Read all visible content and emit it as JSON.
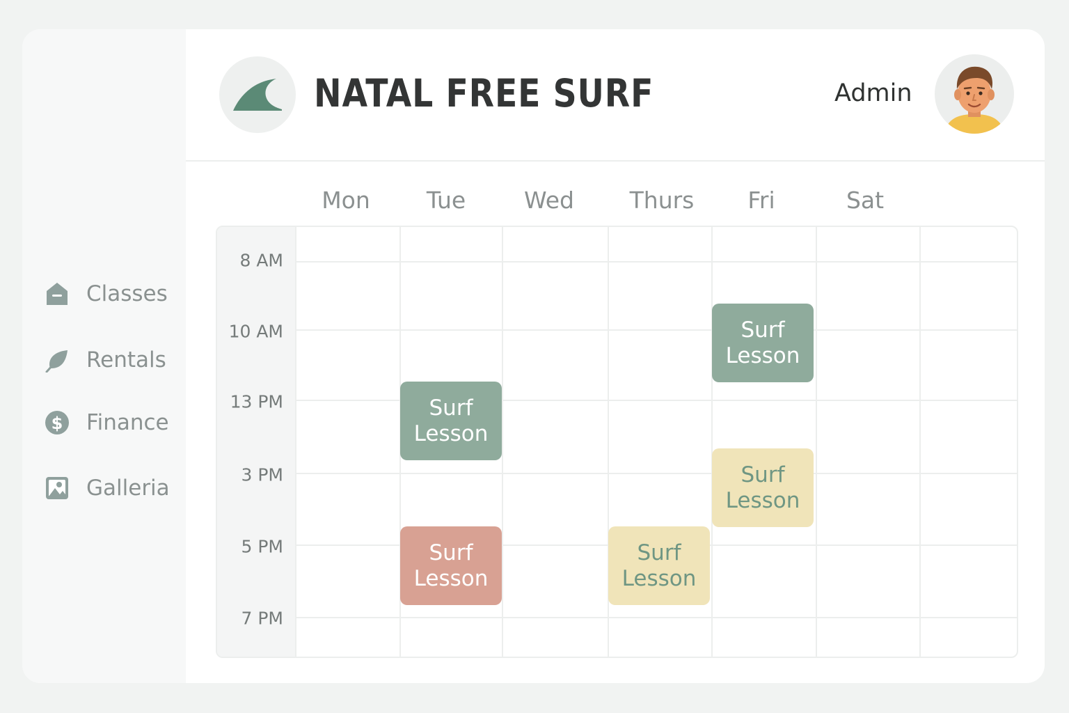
{
  "brand": {
    "name": "NATAL FREE SURF",
    "logo_icon": "wave-fin-icon"
  },
  "user": {
    "name": "Admin",
    "avatar_icon": "user-avatar-icon"
  },
  "sidebar": {
    "items": [
      {
        "label": "Classes",
        "icon": "house-icon"
      },
      {
        "label": "Rentals",
        "icon": "leaf-icon"
      },
      {
        "label": "Finance",
        "icon": "dollar-icon"
      },
      {
        "label": "Galleria",
        "icon": "image-icon"
      }
    ]
  },
  "calendar": {
    "days": [
      "Mon",
      "Tue",
      "Wed",
      "Thurs",
      "Fri",
      "Sat"
    ],
    "times": [
      "8 AM",
      "10 AM",
      "13 PM",
      "3 PM",
      "5 PM",
      "7 PM"
    ],
    "events": [
      {
        "day": "Fri",
        "start": "10 AM",
        "line1": "Surf",
        "line2": "Lesson",
        "color": "#8fab9c"
      },
      {
        "day": "Tue",
        "start": "13 PM",
        "line1": "Surf",
        "line2": "Lesson",
        "color": "#8fab9c"
      },
      {
        "day": "Fri",
        "start": "3 PM",
        "line1": "Surf",
        "line2": "Lesson",
        "color": "#f0e4b9"
      },
      {
        "day": "Tue",
        "start": "5 PM",
        "line1": "Surf",
        "line2": "Lesson",
        "color": "#d8a193"
      },
      {
        "day": "Thurs",
        "start": "5 PM",
        "line1": "Surf",
        "line2": "Lesson",
        "color": "#f0e4b9"
      }
    ]
  },
  "colors": {
    "accent_green": "#8fab9c",
    "accent_yellow": "#f0e4b9",
    "accent_red": "#d8a193",
    "logo_green": "#5b8a76",
    "icon_gray": "#8fa09d"
  }
}
